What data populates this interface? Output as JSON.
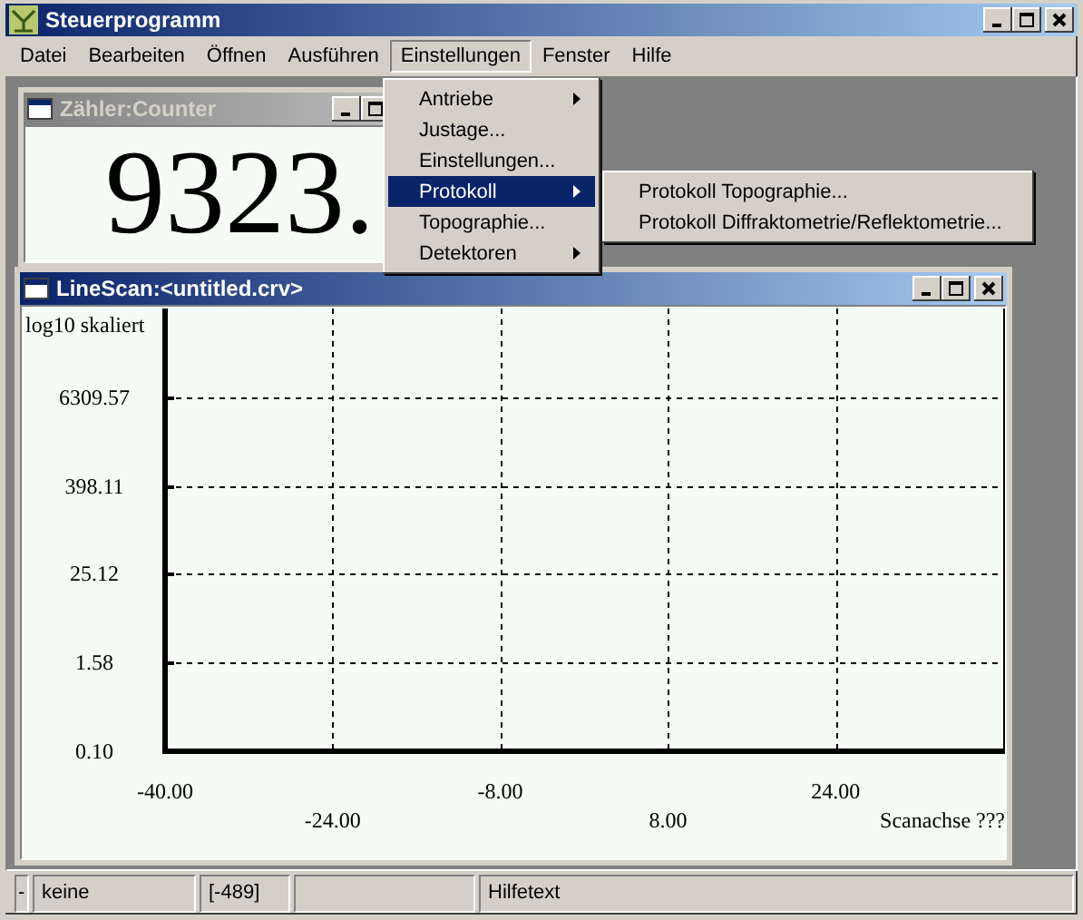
{
  "window": {
    "title": "Steuerprogramm"
  },
  "menu_bar": [
    {
      "label": "Datei",
      "selected": false
    },
    {
      "label": "Bearbeiten",
      "selected": false
    },
    {
      "label": "Öffnen",
      "selected": false
    },
    {
      "label": "Ausführen",
      "selected": false
    },
    {
      "label": "Einstellungen",
      "selected": true
    },
    {
      "label": "Fenster",
      "selected": false
    },
    {
      "label": "Hilfe",
      "selected": false
    }
  ],
  "open_menu": {
    "items": [
      {
        "label": "Antriebe",
        "submenu": true,
        "selected": false
      },
      {
        "label": "Justage...",
        "submenu": false,
        "selected": false
      },
      {
        "label": "Einstellungen...",
        "submenu": false,
        "selected": false
      },
      {
        "label": "Protokoll",
        "submenu": true,
        "selected": true
      },
      {
        "label": "Topographie...",
        "submenu": false,
        "selected": false
      },
      {
        "label": "Detektoren",
        "submenu": true,
        "selected": false
      }
    ]
  },
  "submenu": {
    "items": [
      {
        "label": "Protokoll Topographie...",
        "selected": false
      },
      {
        "label": "Protokoll Diffraktometrie/Reflektometrie...",
        "selected": false
      }
    ]
  },
  "child_windows": [
    {
      "kind": "counter",
      "title": "Zähler:Counter",
      "active": false,
      "value": "9323."
    },
    {
      "kind": "linescan",
      "title": "LineScan:<untitled.crv>",
      "active": true,
      "plot": {
        "x_title": "Scanachse ???",
        "y_title": "log10 skaliert",
        "x_labels": [
          "-40.00",
          "-24.00",
          "-8.00",
          "8.00",
          "24.00"
        ],
        "y_labels": [
          "6309.57",
          "398.11",
          "25.12",
          "1.58",
          "0.10"
        ]
      }
    }
  ],
  "status_bar": {
    "panels": [
      {
        "kind": "text",
        "text": "-"
      },
      {
        "kind": "text",
        "text": "keine"
      },
      {
        "kind": "text",
        "text": "[-489]"
      },
      {
        "kind": "blank"
      },
      {
        "kind": "text",
        "text": "Hilfetext"
      }
    ]
  }
}
